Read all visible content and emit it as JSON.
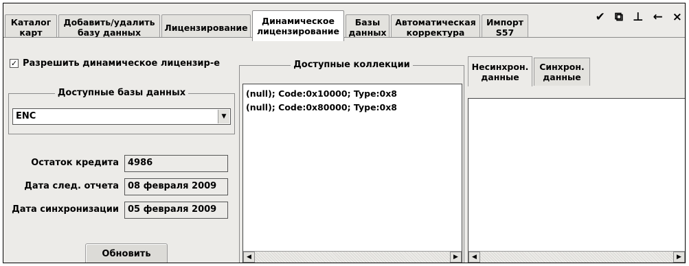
{
  "tabs": [
    {
      "label": "Каталог\nкарт"
    },
    {
      "label": "Добавить/удалить\nбазу данных"
    },
    {
      "label": "Лицензирование"
    },
    {
      "label": "Динамическое\nлицензирование",
      "active": true
    },
    {
      "label": "Базы\nданных"
    },
    {
      "label": "Автоматическая\nкорректура"
    },
    {
      "label": "Импорт\nS57"
    }
  ],
  "titlebar": {
    "icons": [
      "pin-tool-icon",
      "restore-window-icon",
      "dock-icon",
      "back-arrow-icon",
      "close-icon"
    ],
    "glyphs": [
      "✔",
      "⧉",
      "⊥",
      "←",
      "×"
    ]
  },
  "dynamic": {
    "enable_label": "Разрешить динамическое лицензир-е",
    "enable_checked": true,
    "checkmark": "✓",
    "databases_legend": "Доступные базы данных",
    "database_value": "ENC",
    "credit_label": "Остаток кредита",
    "credit_value": "4986",
    "next_report_label": "Дата след. отчета",
    "next_report_value": "08 февраля 2009",
    "sync_date_label": "Дата синхронизации",
    "sync_date_value": "05 февраля 2009",
    "refresh_button": "Обновить"
  },
  "collections": {
    "legend": "Доступные коллекции",
    "items": [
      "(null); Code:0x10000; Type:0x8",
      "(null); Code:0x80000; Type:0x8"
    ]
  },
  "sync_tabs": [
    {
      "label": "Несинхрон.\nданные",
      "active": true
    },
    {
      "label": "Синхрон.\nданные"
    }
  ],
  "glyphs": {
    "dropdown": "▼",
    "scroll_left": "◀",
    "scroll_right": "▶"
  }
}
